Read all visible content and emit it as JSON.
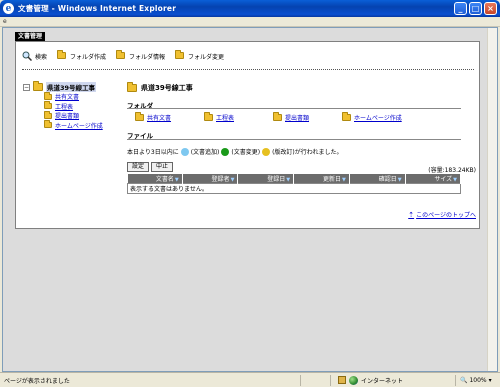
{
  "window": {
    "title": "文書管理 - Windows Internet Explorer"
  },
  "tab_label": "文書管理",
  "toolbar": {
    "search": "検索",
    "create_folder": "フォルダ作成",
    "folder_info": "フォルダ情報",
    "folder_change": "フォルダ変更"
  },
  "tree": {
    "expander": "−",
    "root": "県道39号線工事",
    "items": [
      "共有文書",
      "工程表",
      "提出書類",
      "ホームページ作成"
    ]
  },
  "main": {
    "title": "県道39号線工事",
    "folders_heading": "フォルダ",
    "folders": [
      "共有文書",
      "工程表",
      "提出書類",
      "ホームページ作成"
    ],
    "files_heading": "ファイル",
    "note_prefix": "本日より3日以内に",
    "note_added": "(文書追加)",
    "note_changed": "(文書変更)",
    "note_suffix": "(版改訂)が行われました。",
    "settings_button": "設定",
    "stop_button": "中止",
    "capacity": "(容量:183.24KB)",
    "columns": [
      "文書名",
      "登録者",
      "登録日",
      "更新日",
      "確認日",
      "サイズ"
    ],
    "empty_message": "表示する文書はありません。",
    "page_top": "このページのトップへ"
  },
  "statusbar": {
    "status": "ページが表示されました",
    "zone": "インターネット",
    "zoom": "100%"
  },
  "colors": {
    "added_dot": "#7ec8f0",
    "changed_dot": "#1a9a1a",
    "revised_dot": "#e6c020",
    "header_bg": "#6c6c6c",
    "link": "#0000cc"
  }
}
